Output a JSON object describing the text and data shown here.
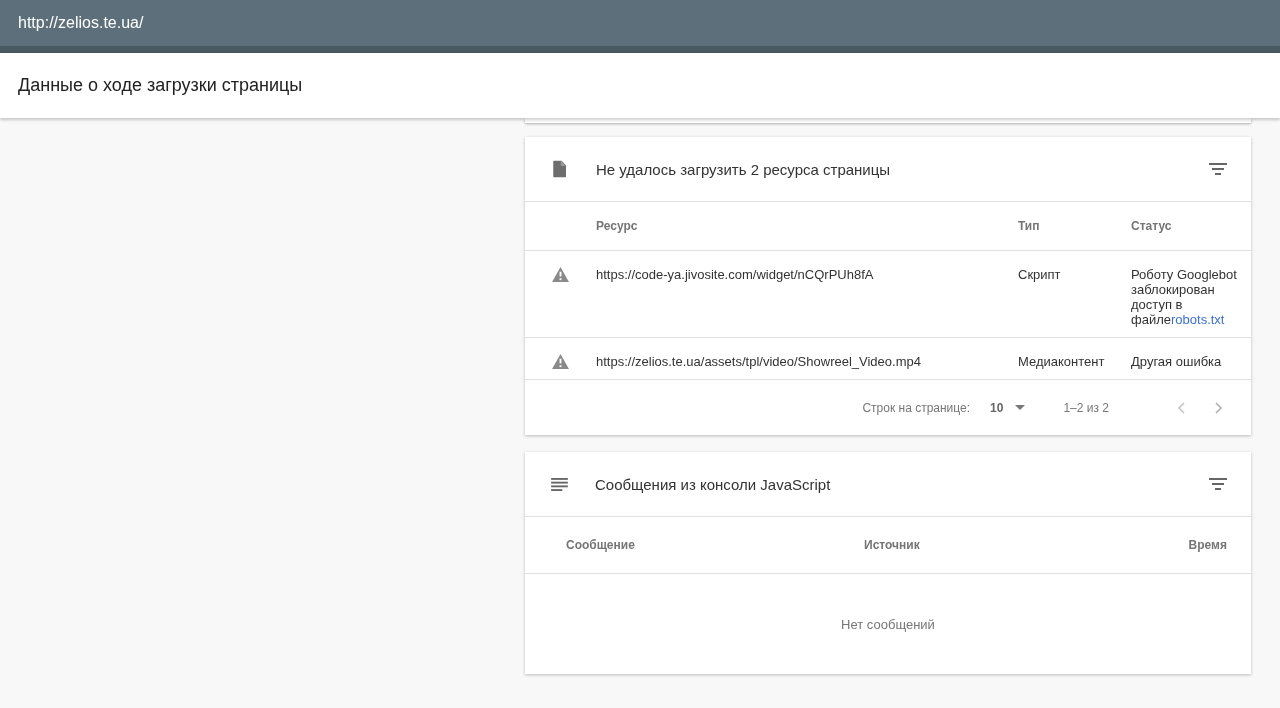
{
  "address_bar": {
    "url": "http://zelios.te.ua/"
  },
  "header": {
    "title": "Данные о ходе загрузки страницы"
  },
  "resources_card": {
    "title": "Не удалось загрузить 2 ресурса страницы",
    "columns": [
      "Ресурс",
      "Тип",
      "Статус"
    ],
    "rows": [
      {
        "kind": "warning",
        "resource": "https://code-ya.jivosite.com/widget/nCQrPUh8fA",
        "type": "Скрипт",
        "status": "Роботу Googlebot заблокирован доступ в файле",
        "status_link": "robots.txt"
      },
      {
        "kind": "warning",
        "resource": "https://zelios.te.ua/assets/tpl/video/Showreel_Video.mp4",
        "type": "Медиаконтент",
        "status": "Другая ошибка"
      }
    ],
    "pagination": {
      "rows_label": "Строк на странице:",
      "rows_value": "10",
      "range": "1–2 из 2"
    }
  },
  "console_card": {
    "title": "Сообщения из консоли JavaScript",
    "columns": [
      "Сообщение",
      "Источник",
      "Время"
    ],
    "empty_text": "Нет сообщений"
  }
}
